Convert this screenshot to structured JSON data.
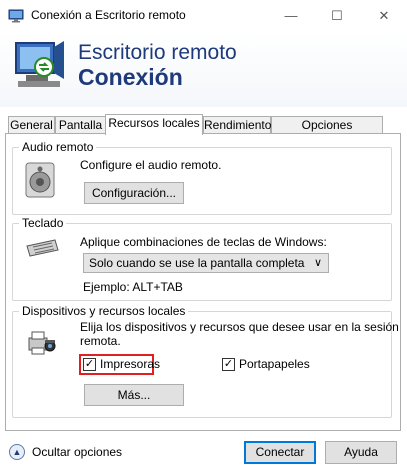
{
  "window": {
    "title": "Conexión a Escritorio remoto",
    "controls": {
      "minimize": "—",
      "maximize": "☐",
      "close": "✕"
    }
  },
  "banner": {
    "line1": "Escritorio remoto",
    "line2": "Conexión"
  },
  "tabs": [
    {
      "label": "General"
    },
    {
      "label": "Pantalla"
    },
    {
      "label": "Recursos locales",
      "active": true
    },
    {
      "label": "Rendimiento"
    },
    {
      "label": "Opciones avanzadas"
    }
  ],
  "audio": {
    "group_label": "Audio remoto",
    "description": "Configure el audio remoto.",
    "button_label": "Configuración..."
  },
  "keyboard": {
    "group_label": "Teclado",
    "description": "Aplique combinaciones de teclas de Windows:",
    "select_value": "Solo cuando se use la pantalla completa",
    "example": "Ejemplo: ALT+TAB"
  },
  "devices": {
    "group_label": "Dispositivos y recursos locales",
    "description_line1": "Elija los dispositivos y recursos que desee usar en la sesión",
    "description_line2": "remota.",
    "printers_label": "Impresoras",
    "printers_checked": true,
    "clipboard_label": "Portapapeles",
    "clipboard_checked": true,
    "more_button_label": "Más..."
  },
  "footer": {
    "hide_options_label": "Ocultar opciones",
    "connect_label": "Conectar",
    "help_label": "Ayuda"
  },
  "colors": {
    "brand_text": "#1f3a7a",
    "highlight": "#e02020",
    "accent": "#0078d7"
  }
}
